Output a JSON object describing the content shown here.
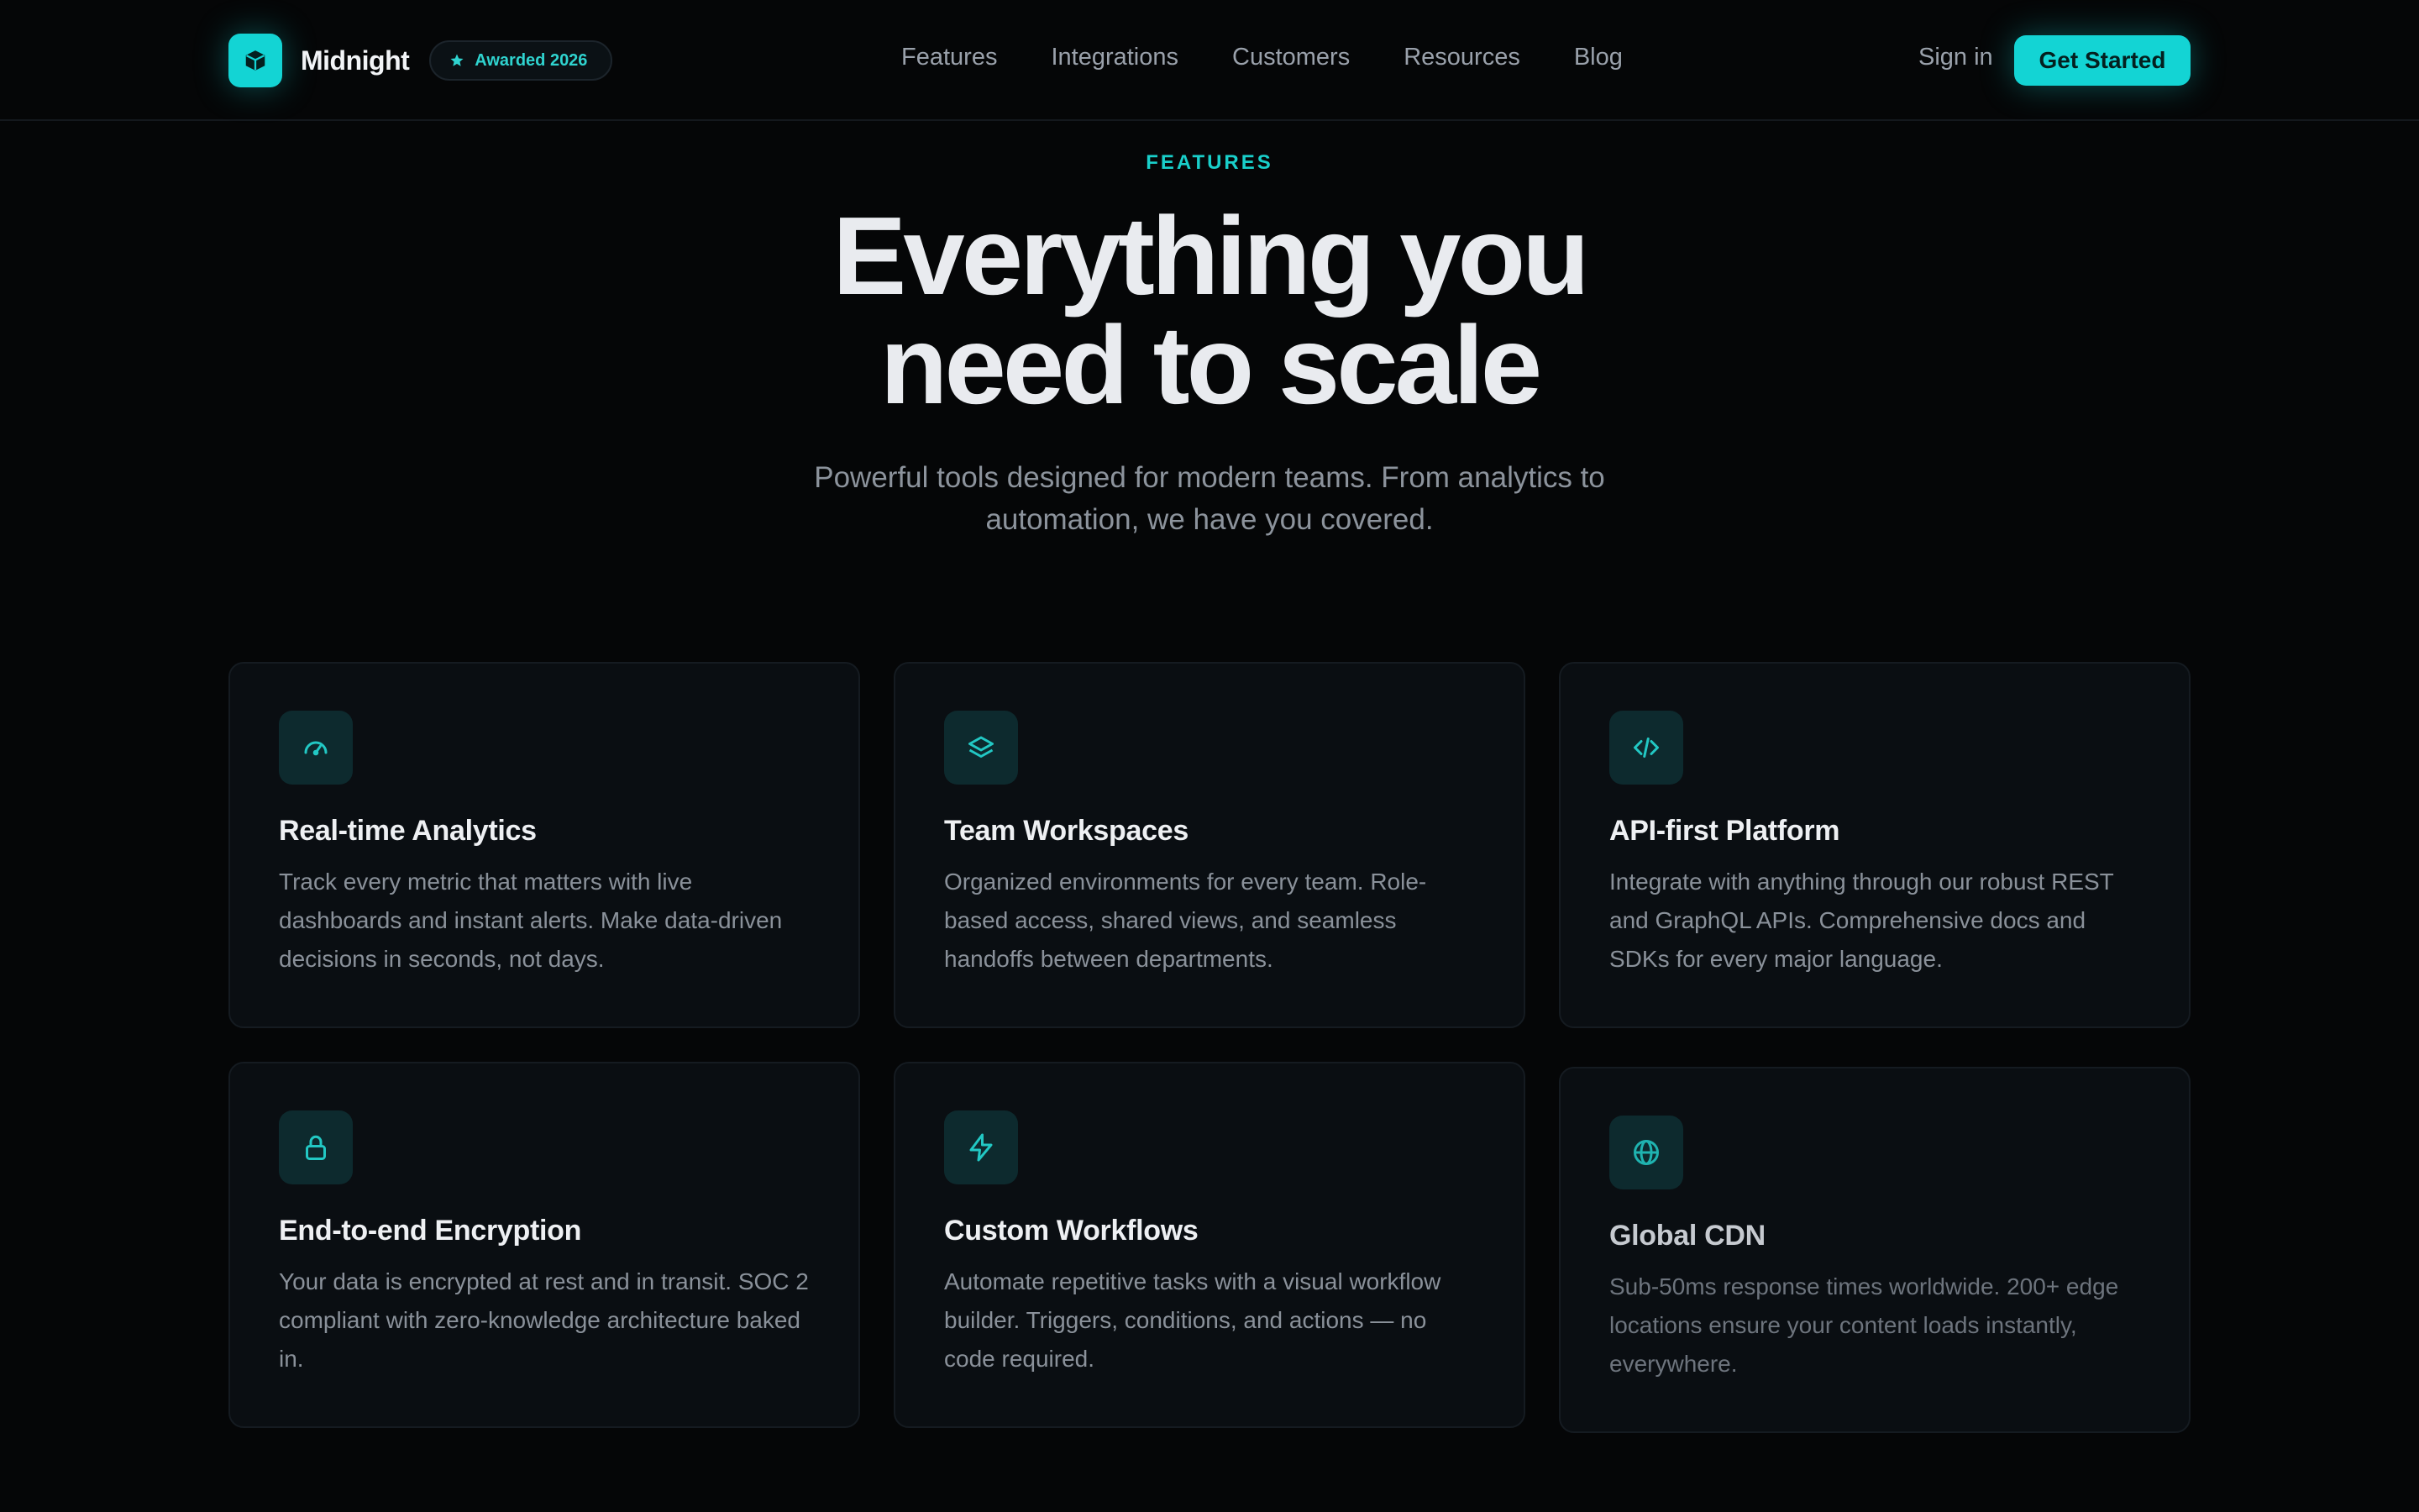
{
  "nav": {
    "brand": "Midnight",
    "badge": "Awarded 2026",
    "links": [
      "Features",
      "Integrations",
      "Customers",
      "Resources",
      "Blog"
    ],
    "sign_in": "Sign in",
    "cta": "Get Started"
  },
  "hero": {
    "eyebrow": "FEATURES",
    "title_line1": "Everything you",
    "title_line2": "need to scale",
    "subtitle": "Powerful tools designed for modern teams. From analytics to automation, we have you covered."
  },
  "features": [
    {
      "icon": "gauge-icon",
      "title": "Real-time Analytics",
      "description": "Track every metric that matters with live dashboards and instant alerts. Make data-driven decisions in seconds, not days."
    },
    {
      "icon": "layers-icon",
      "title": "Team Workspaces",
      "description": "Organized environments for every team. Role-based access, shared views, and seamless handoffs between departments."
    },
    {
      "icon": "code-icon",
      "title": "API-first Platform",
      "description": "Integrate with anything through our robust REST and GraphQL APIs. Comprehensive docs and SDKs for every major language."
    },
    {
      "icon": "lock-icon",
      "title": "End-to-end Encryption",
      "description": "Your data is encrypted at rest and in transit. SOC 2 compliant with zero-knowledge architecture baked in."
    },
    {
      "icon": "lightning-icon",
      "title": "Custom Workflows",
      "description": "Automate repetitive tasks with a visual workflow builder. Triggers, conditions, and actions — no code required."
    },
    {
      "icon": "globe-icon",
      "title": "Global CDN",
      "description": "Sub-50ms response times worldwide. 200+ edge locations ensure your content loads instantly, everywhere."
    }
  ],
  "colors": {
    "accent": "#13d4d4",
    "background": "#050607",
    "card": "#0a0e12"
  }
}
